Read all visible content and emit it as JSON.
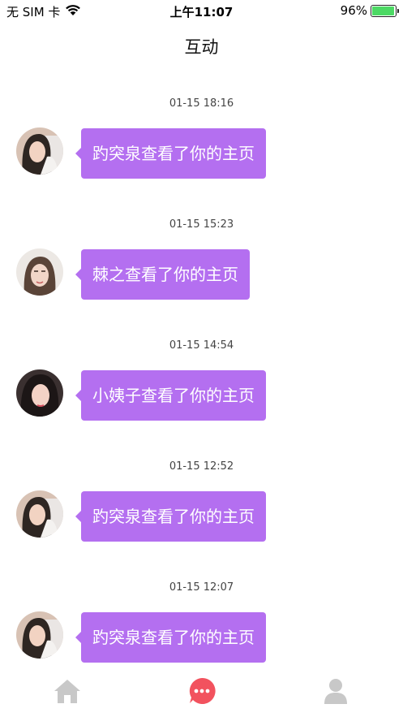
{
  "status_bar": {
    "carrier": "无 SIM 卡",
    "time": "上午11:07",
    "battery": "96%",
    "battery_level": 0.96,
    "wifi_icon": "wifi-icon"
  },
  "nav": {
    "title": "互动"
  },
  "entries": [
    {
      "time": "01-15 18:16",
      "text": "趵突泉查看了你的主页",
      "avatar": "avatar-1"
    },
    {
      "time": "01-15 15:23",
      "text": "棘之查看了你的主页",
      "avatar": "avatar-2"
    },
    {
      "time": "01-15 14:54",
      "text": "小姨子查看了你的主页",
      "avatar": "avatar-3"
    },
    {
      "time": "01-15 12:52",
      "text": "趵突泉查看了你的主页",
      "avatar": "avatar-1"
    },
    {
      "time": "01-15 12:07",
      "text": "趵突泉查看了你的主页",
      "avatar": "avatar-1"
    }
  ],
  "tab_bar": {
    "tabs": [
      {
        "icon": "home-icon",
        "active": false
      },
      {
        "icon": "message-icon",
        "active": true
      },
      {
        "icon": "user-icon",
        "active": false
      }
    ],
    "active_color": "#f2525e",
    "inactive_color": "#c8c8c8"
  },
  "colors": {
    "bubble": "#b46ff0"
  }
}
